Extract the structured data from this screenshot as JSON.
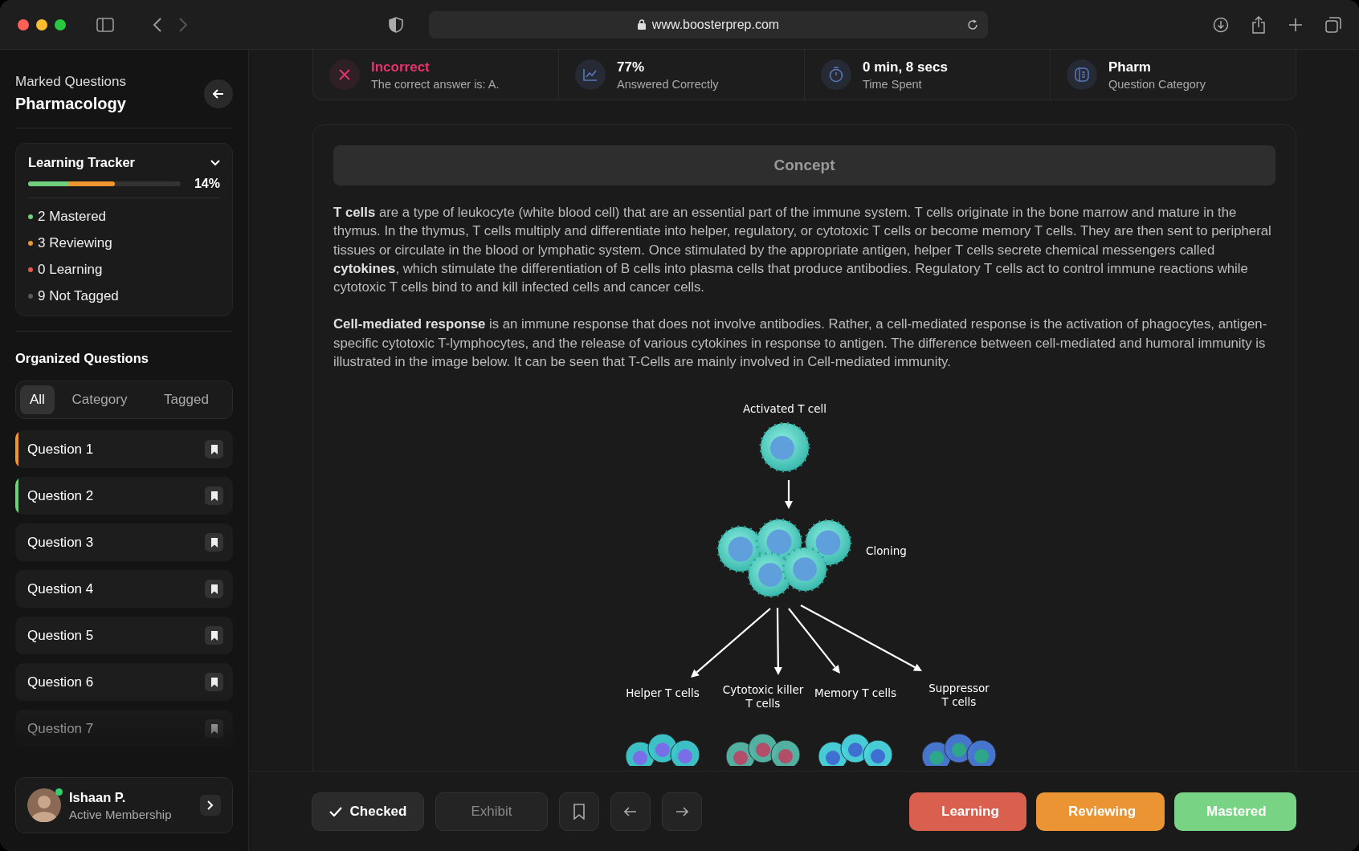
{
  "browser": {
    "url": "www.boosterprep.com"
  },
  "sidebar": {
    "overline": "Marked Questions",
    "title": "Pharmacology",
    "tracker": {
      "title": "Learning Tracker",
      "percent": "14%",
      "segments": [
        {
          "color": "#6fd07c",
          "level": 0.27
        },
        {
          "color": "#f0962f",
          "level": 0.57
        }
      ],
      "legend": [
        {
          "label": "2 Mastered",
          "color": "#6fd07c"
        },
        {
          "label": "3 Reviewing",
          "color": "#f0962f"
        },
        {
          "label": "0 Learning",
          "color": "#e8564e"
        },
        {
          "label": "9 Not Tagged",
          "color": "#5a5a5a"
        }
      ]
    },
    "organized_title": "Organized Questions",
    "tabs": [
      {
        "label": "All",
        "selected": true
      },
      {
        "label": "Category",
        "selected": false
      },
      {
        "label": "Tagged",
        "selected": false
      }
    ],
    "questions": [
      {
        "label": "Question 1",
        "color": "#f0962f"
      },
      {
        "label": "Question 2",
        "color": "#6fd07c"
      },
      {
        "label": "Question 3"
      },
      {
        "label": "Question 4"
      },
      {
        "label": "Question 5"
      },
      {
        "label": "Question 6"
      },
      {
        "label": "Question 7"
      }
    ],
    "profile": {
      "name": "Ishaan P.",
      "subtitle": "Active Membership",
      "online": true
    }
  },
  "stats": [
    {
      "kind": "incorrect",
      "value": "Incorrect",
      "label": "The correct answer is: A."
    },
    {
      "kind": "chart",
      "value": "77%",
      "label": "Answered Correctly"
    },
    {
      "kind": "timer",
      "value": "0 min, 8 secs",
      "label": "Time Spent"
    },
    {
      "kind": "category",
      "value": "Pharm",
      "label": "Question Category"
    }
  ],
  "concept": {
    "title": "Concept",
    "paragraphs": [
      "**T cells** are a type of leukocyte (white blood cell) that are an essential part of the immune system. T cells originate in the bone marrow and mature in the thymus. In the thymus, T cells multiply and differentiate into helper, regulatory, or cytotoxic T cells or become memory T cells. They are then sent to peripheral tissues or circulate in the blood or lymphatic system. Once stimulated by the appropriate antigen, helper T cells secrete chemical messengers called **cytokines**, which stimulate the differentiation of B cells into plasma cells that produce antibodies. Regulatory T cells act to control immune reactions while cytotoxic T cells bind to and kill infected cells and cancer cells.",
      "**Cell-mediated response** is an immune response that does not involve antibodies. Rather, a cell-mediated response is the activation of phagocytes, antigen-specific cytotoxic T-lymphocytes, and the release of various cytokines in response to antigen. The difference between cell-mediated and humoral immunity is illustrated in the image below. It can be seen that T-Cells are mainly involved in Cell-mediated immunity."
    ],
    "figure_labels": [
      {
        "lines": [
          "Activated T cell"
        ]
      },
      {
        "lines": [
          "Cloning"
        ]
      },
      {
        "lines": [
          "Helper T cells"
        ]
      },
      {
        "lines": [
          "Cytotoxic killer",
          "T cells"
        ]
      },
      {
        "lines": [
          "Memory T cells"
        ]
      },
      {
        "lines": [
          "Suppressor",
          "T cells"
        ]
      }
    ]
  },
  "actions": [
    {
      "kind": "check",
      "label": "Checked",
      "disabled": false
    },
    {
      "kind": "text",
      "label": "Exhibit",
      "disabled": true
    },
    {
      "kind": "bookmark"
    },
    {
      "kind": "prev"
    },
    {
      "kind": "next"
    }
  ],
  "status_buttons": [
    {
      "label": "Learning",
      "color": "#d95f4f"
    },
    {
      "label": "Reviewing",
      "color": "#ea9433"
    },
    {
      "label": "Mastered",
      "color": "#79d385"
    }
  ]
}
